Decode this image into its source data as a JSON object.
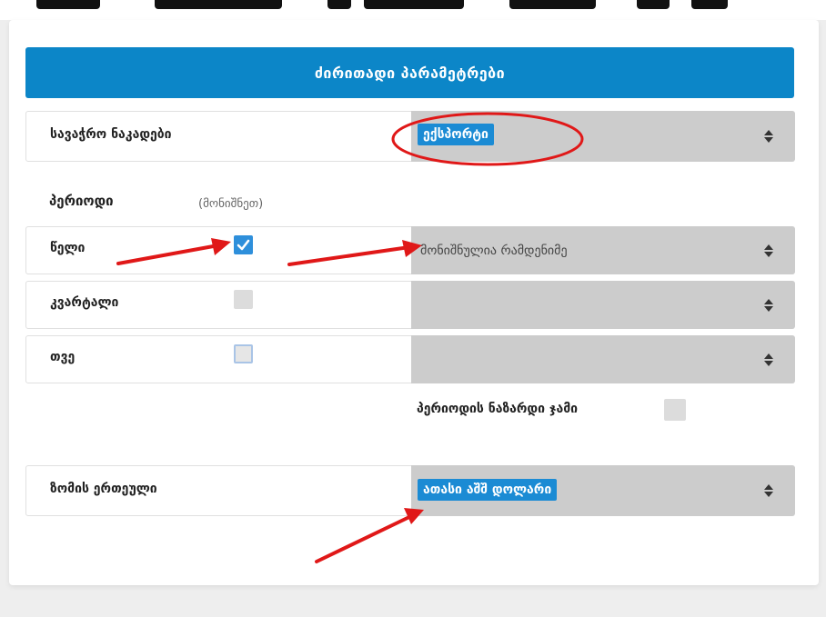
{
  "colors": {
    "accent": "#0c86c8",
    "chip": "#1b8bd4",
    "select_bg": "#cccccc",
    "annotation_red": "#e01818"
  },
  "header": {
    "title": "ძირითადი პარამეტრები"
  },
  "trade_flows": {
    "label": "სავაჭრო ნაკადები",
    "selected": "ექსპორტი"
  },
  "period": {
    "title": "პერიოდი",
    "hint": "(მონიშნეთ)",
    "rows": [
      {
        "label": "წელი",
        "checked": true,
        "select_text": "მონიშნულია რამდენიმე"
      },
      {
        "label": "კვარტალი",
        "checked": false,
        "select_text": ""
      },
      {
        "label": "თვე",
        "checked": false,
        "select_text": ""
      }
    ],
    "cumulative_label": "პერიოდის ნაზარდი ჯამი"
  },
  "unit": {
    "label": "ზომის ერთეული",
    "selected": "ათასი აშშ დოლარი"
  },
  "icons": {
    "select_arrows": "updown-arrows-icon",
    "checkmark": "checkmark-icon"
  }
}
